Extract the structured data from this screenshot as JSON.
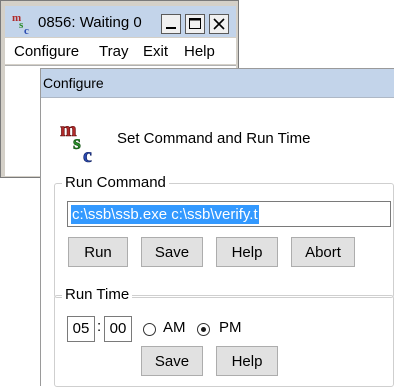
{
  "main_window": {
    "title": "0856: Waiting 0",
    "menu": [
      "Configure",
      "Tray",
      "Exit",
      "Help"
    ]
  },
  "dialog": {
    "title": "Configure",
    "heading": "Set Command and Run Time",
    "run_command": {
      "label": "Run Command",
      "value": "c:\\ssb\\ssb.exe c:\\ssb\\verify.t",
      "buttons": [
        "Run",
        "Save",
        "Help",
        "Abort"
      ]
    },
    "run_time": {
      "label": "Run Time",
      "hour": "05",
      "separator": ":",
      "minute": "00",
      "am_label": "AM",
      "pm_label": "PM",
      "selected": "PM",
      "buttons": [
        "Save",
        "Help"
      ]
    }
  },
  "colors": {
    "titlebar": "#c3d4ea",
    "selection": "#3399ff",
    "logo_m": "#b02a2a",
    "logo_s": "#2a8a2a",
    "logo_c": "#2a4ab0"
  },
  "icons": [
    "app-logo-icon",
    "minimize-icon",
    "maximize-icon",
    "close-icon"
  ]
}
